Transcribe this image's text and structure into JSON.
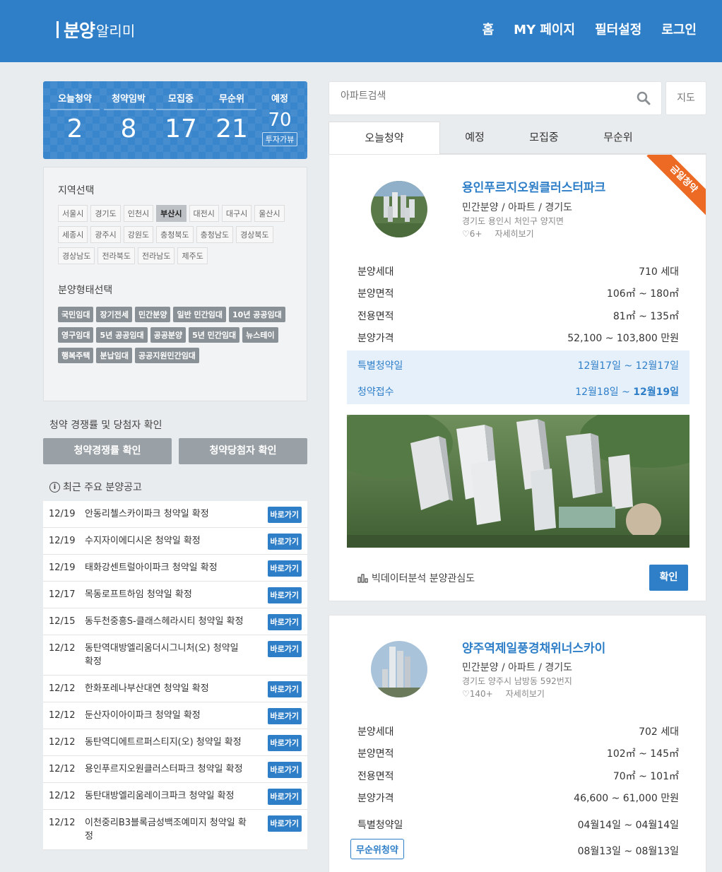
{
  "header": {
    "logo_big": "분양",
    "logo_small": "알리미",
    "nav": [
      "홈",
      "MY 페이지",
      "필터설정",
      "로그인"
    ]
  },
  "stats": [
    {
      "label": "오늘청약",
      "value": "2"
    },
    {
      "label": "청약임박",
      "value": "8"
    },
    {
      "label": "모집중",
      "value": "17"
    },
    {
      "label": "무순위",
      "value": "21"
    },
    {
      "label": "예정",
      "value": "70",
      "extra": "투자가뷰"
    }
  ],
  "filter": {
    "region_title": "지역선택",
    "regions": [
      "서울시",
      "경기도",
      "인천시",
      "부산시",
      "대전시",
      "대구시",
      "울산시",
      "세종시",
      "광주시",
      "강원도",
      "충청북도",
      "충청남도",
      "경상북도",
      "경상남도",
      "전라북도",
      "전라남도",
      "제주도"
    ],
    "region_selected": "부산시",
    "type_title": "분양형태선택",
    "types": [
      "국민임대",
      "장기전세",
      "민간분양",
      "일반 민간임대",
      "10년 공공임대",
      "영구임대",
      "5년 공공임대",
      "공공분양",
      "5년 민간임대",
      "뉴스테이",
      "행복주택",
      "분납임대",
      "공공지원민간임대"
    ]
  },
  "competition": {
    "label": "청약 경쟁률 및 당첨자 확인",
    "rate_button": "청약경쟁률 확인",
    "winner_button": "청약당첨자 확인"
  },
  "recent": {
    "title": "최근 주요 분양공고",
    "go_label": "바로가기",
    "items": [
      {
        "date": "12/19",
        "text": "안동리첼스카이파크 청약일 확정"
      },
      {
        "date": "12/19",
        "text": "수지자이에디시온 청약일 확정"
      },
      {
        "date": "12/19",
        "text": "태화강센트럴아이파크 청약일 확정"
      },
      {
        "date": "12/17",
        "text": "목동로프트하임 청약일 확정"
      },
      {
        "date": "12/15",
        "text": "동두천중흥S-클래스헤라시티 청약일 확정"
      },
      {
        "date": "12/12",
        "text": "동탄역대방엘리움더시그니처(오) 청약일 확정"
      },
      {
        "date": "12/12",
        "text": "한화포레나부산대연 청약일 확정"
      },
      {
        "date": "12/12",
        "text": "둔산자이아이파크 청약일 확정"
      },
      {
        "date": "12/12",
        "text": "동탄역디에트르퍼스티지(오) 청약일 확정"
      },
      {
        "date": "12/12",
        "text": "용인푸르지오원클러스터파크 청약일 확정"
      },
      {
        "date": "12/12",
        "text": "동탄대방엘리움레이크파크 청약일 확정"
      },
      {
        "date": "12/12",
        "text": "이천중리B3블록금성백조예미지 청약일 확정"
      }
    ]
  },
  "search": {
    "placeholder": "아파트검색",
    "map_label": "지도"
  },
  "tabs": [
    "오늘청약",
    "예정",
    "모집중",
    "무순위"
  ],
  "cards": [
    {
      "ribbon": "금일청약",
      "title": "용인푸르지오원클러스터파크",
      "subtitle": "민간분양 / 아파트 / 경기도",
      "address": "경기도 용인시 처인구 양지면",
      "likes": "6+",
      "detail": "자세히보기",
      "rows": [
        {
          "k": "분양세대",
          "v": "710 세대"
        },
        {
          "k": "분양면적",
          "v": "106㎡ ~ 180㎡"
        },
        {
          "k": "전용면적",
          "v": "81㎡ ~ 135㎡"
        },
        {
          "k": "분양가격",
          "v": "52,100 ~ 103,800 만원"
        }
      ],
      "special_label": "특별청약일",
      "special_value": "12월17일 ~ 12월17일",
      "receipt_label": "청약접수",
      "receipt_value_start": "12월18일 ~ ",
      "receipt_value_end": "12월19일",
      "bigdata": "빅데이터분석 분양관심도",
      "confirm": "확인"
    },
    {
      "title": "양주역제일풍경채위너스카이",
      "subtitle": "민간분양 / 아파트 / 경기도",
      "address": "경기도 양주시 남방동 592번지",
      "likes": "140+",
      "detail": "자세히보기",
      "rows": [
        {
          "k": "분양세대",
          "v": "702 세대"
        },
        {
          "k": "분양면적",
          "v": "102㎡ ~ 145㎡"
        },
        {
          "k": "전용면적",
          "v": "70㎡ ~ 101㎡"
        },
        {
          "k": "분양가격",
          "v": "46,600 ~ 61,000 만원"
        }
      ],
      "special_label": "특별청약일",
      "special_value": "04월14일 ~ 04월14일",
      "unordered_label": "무순위청약",
      "unordered_value": "08월13일 ~ 08월13일"
    }
  ],
  "colors": {
    "primary": "#2f7fc8",
    "ribbon": "#ec6a24",
    "highlight": "#e5f0fb"
  }
}
